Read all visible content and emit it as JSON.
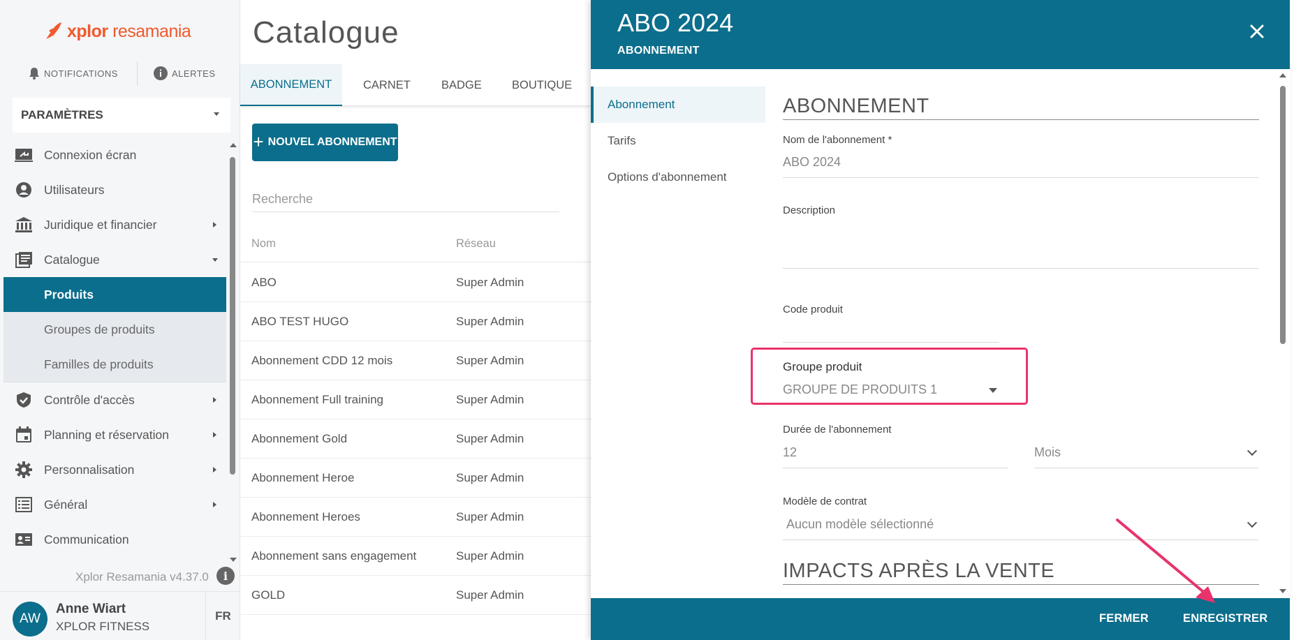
{
  "brand": {
    "name_bold": "xplor",
    "name_light": "resamania",
    "accent": "#ef5a2e",
    "primary": "#0b6e8c",
    "highlight": "#e8336b"
  },
  "topbar": {
    "notifications": "NOTIFICATIONS",
    "alerts": "ALERTES"
  },
  "params": {
    "label": "PARAMÈTRES"
  },
  "sidebar": {
    "items": [
      {
        "label": "Connexion écran",
        "icon": "screen-login-icon"
      },
      {
        "label": "Utilisateurs",
        "icon": "user-circle-icon"
      },
      {
        "label": "Juridique et financier",
        "icon": "bank-icon"
      },
      {
        "label": "Catalogue",
        "icon": "catalogue-icon"
      }
    ],
    "catalogue_sub": [
      {
        "label": "Produits",
        "active": true
      },
      {
        "label": "Groupes de produits"
      },
      {
        "label": "Familles de produits"
      }
    ],
    "items_after": [
      {
        "label": "Contrôle d'accès",
        "icon": "shield-check-icon"
      },
      {
        "label": "Planning et réservation",
        "icon": "calendar-icon"
      },
      {
        "label": "Personnalisation",
        "icon": "gear-icon"
      },
      {
        "label": "Général",
        "icon": "list-icon"
      },
      {
        "label": "Communication",
        "icon": "contact-card-icon"
      }
    ],
    "version": "Xplor Resamania v4.37.0"
  },
  "user": {
    "initials": "AW",
    "name": "Anne Wiart",
    "org": "XPLOR FITNESS",
    "lang": "FR"
  },
  "catalogue": {
    "title": "Catalogue",
    "tabs": [
      "ABONNEMENT",
      "CARNET",
      "BADGE",
      "BOUTIQUE"
    ],
    "new_button": "NOUVEL ABONNEMENT",
    "search_placeholder": "Recherche",
    "columns": [
      "Nom",
      "Réseau"
    ],
    "rows": [
      {
        "name": "ABO",
        "network": "Super Admin"
      },
      {
        "name": "ABO TEST HUGO",
        "network": "Super Admin"
      },
      {
        "name": "Abonnement CDD 12 mois",
        "network": "Super Admin"
      },
      {
        "name": "Abonnement Full training",
        "network": "Super Admin"
      },
      {
        "name": "Abonnement Gold",
        "network": "Super Admin"
      },
      {
        "name": "Abonnement Heroe",
        "network": "Super Admin"
      },
      {
        "name": "Abonnement Heroes",
        "network": "Super Admin"
      },
      {
        "name": "Abonnement sans engagement",
        "network": "Super Admin"
      },
      {
        "name": "GOLD",
        "network": "Super Admin"
      }
    ]
  },
  "panel": {
    "title": "ABO 2024",
    "subtitle": "ABONNEMENT",
    "nav": [
      "Abonnement",
      "Tarifs",
      "Options d'abonnement"
    ],
    "section_title": "ABONNEMENT",
    "fields": {
      "name_label": "Nom de l'abonnement *",
      "name_value": "ABO 2024",
      "description_label": "Description",
      "code_label": "Code produit",
      "group_label": "Groupe produit",
      "group_value": "GROUPE DE PRODUITS 1",
      "duration_label": "Durée de l'abonnement",
      "duration_value": "12",
      "duration_unit": "Mois",
      "contract_label": "Modèle de contrat",
      "contract_value": "Aucun modèle sélectionné"
    },
    "section2_title": "IMPACTS APRÈS LA VENTE",
    "footer": {
      "close": "FERMER",
      "save": "ENREGISTRER"
    }
  }
}
